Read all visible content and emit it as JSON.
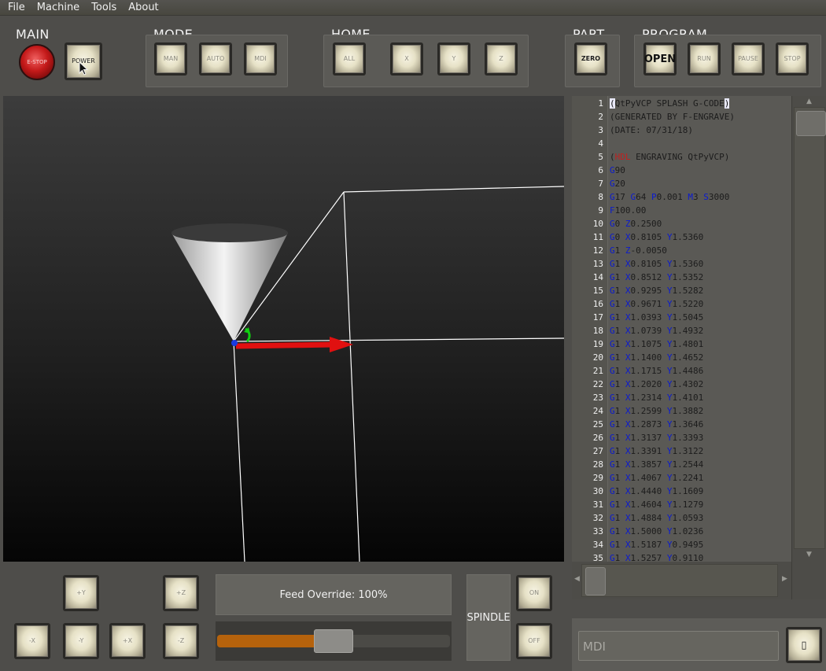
{
  "menu": [
    "File",
    "Machine",
    "Tools",
    "About"
  ],
  "main": {
    "title": "MAIN",
    "estop_label": "E-STOP",
    "power_label": "POWER"
  },
  "mode": {
    "title": "MODE",
    "buttons": [
      "MAN",
      "AUTO",
      "MDI"
    ]
  },
  "home": {
    "title": "HOME",
    "buttons": [
      "ALL",
      "X",
      "Y",
      "Z"
    ]
  },
  "part": {
    "title": "PART",
    "zero_label": "ZERO"
  },
  "program": {
    "title": "PROGRAM",
    "buttons": [
      "OPEN",
      "RUN",
      "PAUSE",
      "STOP"
    ]
  },
  "gcode": {
    "lines": [
      {
        "n": "1",
        "t": "(QtPyVCP SPLASH G-CODE)"
      },
      {
        "n": "2",
        "t": "(GENERATED BY F-ENGRAVE)"
      },
      {
        "n": "3",
        "t": "(DATE: 07/31/18)"
      },
      {
        "n": "4",
        "t": ""
      },
      {
        "n": "5",
        "t": "(HDL ENGRAVING QtPyVCP)"
      },
      {
        "n": "6",
        "t": "G90"
      },
      {
        "n": "7",
        "t": "G20"
      },
      {
        "n": "8",
        "t": "G17 G64 P0.001 M3 S3000"
      },
      {
        "n": "9",
        "t": "F100.00"
      },
      {
        "n": "10",
        "t": "G0 Z0.2500"
      },
      {
        "n": "11",
        "t": "G0 X0.8105 Y1.5360"
      },
      {
        "n": "12",
        "t": "G1 Z-0.0050"
      },
      {
        "n": "13",
        "t": "G1 X0.8105 Y1.5360"
      },
      {
        "n": "14",
        "t": "G1 X0.8512 Y1.5352"
      },
      {
        "n": "15",
        "t": "G1 X0.9295 Y1.5282"
      },
      {
        "n": "16",
        "t": "G1 X0.9671 Y1.5220"
      },
      {
        "n": "17",
        "t": "G1 X1.0393 Y1.5045"
      },
      {
        "n": "18",
        "t": "G1 X1.0739 Y1.4932"
      },
      {
        "n": "19",
        "t": "G1 X1.1075 Y1.4801"
      },
      {
        "n": "20",
        "t": "G1 X1.1400 Y1.4652"
      },
      {
        "n": "21",
        "t": "G1 X1.1715 Y1.4486"
      },
      {
        "n": "22",
        "t": "G1 X1.2020 Y1.4302"
      },
      {
        "n": "23",
        "t": "G1 X1.2314 Y1.4101"
      },
      {
        "n": "24",
        "t": "G1 X1.2599 Y1.3882"
      },
      {
        "n": "25",
        "t": "G1 X1.2873 Y1.3646"
      },
      {
        "n": "26",
        "t": "G1 X1.3137 Y1.3393"
      },
      {
        "n": "27",
        "t": "G1 X1.3391 Y1.3122"
      },
      {
        "n": "28",
        "t": "G1 X1.3857 Y1.2544"
      },
      {
        "n": "29",
        "t": "G1 X1.4067 Y1.2241"
      },
      {
        "n": "30",
        "t": "G1 X1.4440 Y1.1609"
      },
      {
        "n": "31",
        "t": "G1 X1.4604 Y1.1279"
      },
      {
        "n": "32",
        "t": "G1 X1.4884 Y1.0593"
      },
      {
        "n": "33",
        "t": "G1 X1.5000 Y1.0236"
      },
      {
        "n": "34",
        "t": "G1 X1.5187 Y0.9495"
      },
      {
        "n": "35",
        "t": "G1 X1.5257 Y0.9110"
      }
    ]
  },
  "jog": {
    "buttons": [
      "+Y",
      "+Z",
      "-X",
      "-Y",
      "+X",
      "-Z"
    ]
  },
  "feed": {
    "label": "Feed Override: 100%",
    "value_fraction": 0.5
  },
  "spindle": {
    "label": "SPINDLE",
    "on_label": "ON",
    "off_label": "OFF"
  },
  "mdi": {
    "placeholder": "MDI",
    "button_icon": "▯"
  },
  "colors": {
    "keyword_blue": "#0a1ad0",
    "comment_red": "#c02020",
    "slider_fill": "#b5620c"
  }
}
